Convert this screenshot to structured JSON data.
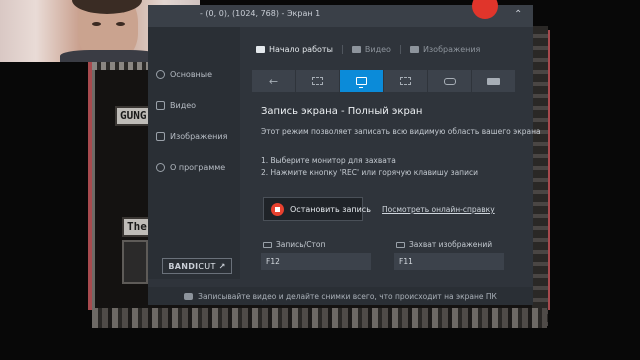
{
  "window": {
    "title": "- (0, 0), (1024, 768) - Экран 1",
    "collapse_icon": "chevron-up-icon"
  },
  "sidebar": {
    "items": [
      {
        "label": "Основные",
        "icon": "gear-icon"
      },
      {
        "label": "Видео",
        "icon": "video-icon"
      },
      {
        "label": "Изображения",
        "icon": "image-icon"
      },
      {
        "label": "О программе",
        "icon": "info-icon"
      }
    ],
    "bandicut": {
      "brand": "BANDI",
      "brand_cut": "CUT",
      "arrow": "↗"
    }
  },
  "tabs": [
    {
      "label": "Начало работы",
      "icon": "home-icon",
      "active": true
    },
    {
      "label": "Видео",
      "icon": "video-icon",
      "active": false
    },
    {
      "label": "Изображения",
      "icon": "image-icon",
      "active": false
    }
  ],
  "modes": [
    {
      "icon": "back-arrow-icon",
      "glyph": "←"
    },
    {
      "icon": "rectangle-area-icon"
    },
    {
      "icon": "fullscreen-icon",
      "active": true
    },
    {
      "icon": "around-mouse-icon"
    },
    {
      "icon": "gamepad-icon"
    },
    {
      "icon": "hdmi-device-icon"
    }
  ],
  "content": {
    "heading": "Запись экрана - Полный экран",
    "description": "Этот режим позволяет записать всю видимую область вашего экрана",
    "steps": [
      "1. Выберите монитор для захвата",
      "2. Нажмите кнопку 'REC' или горячую клавишу записи"
    ],
    "stop_button": "Остановить запись",
    "help_link": "Посмотреть онлайн-справку"
  },
  "hotkeys": {
    "record": {
      "label": "Запись/Стоп",
      "value": "F12"
    },
    "capture": {
      "label": "Захват изображений",
      "value": "F11"
    }
  },
  "footer": {
    "text": "Записывайте видео и делайте снимки всего, что происходит на экране ПК"
  },
  "background": {
    "tags": [
      "GUNG",
      "The"
    ]
  },
  "colors": {
    "accent": "#0b8bd9",
    "record_red": "#e8412f"
  }
}
